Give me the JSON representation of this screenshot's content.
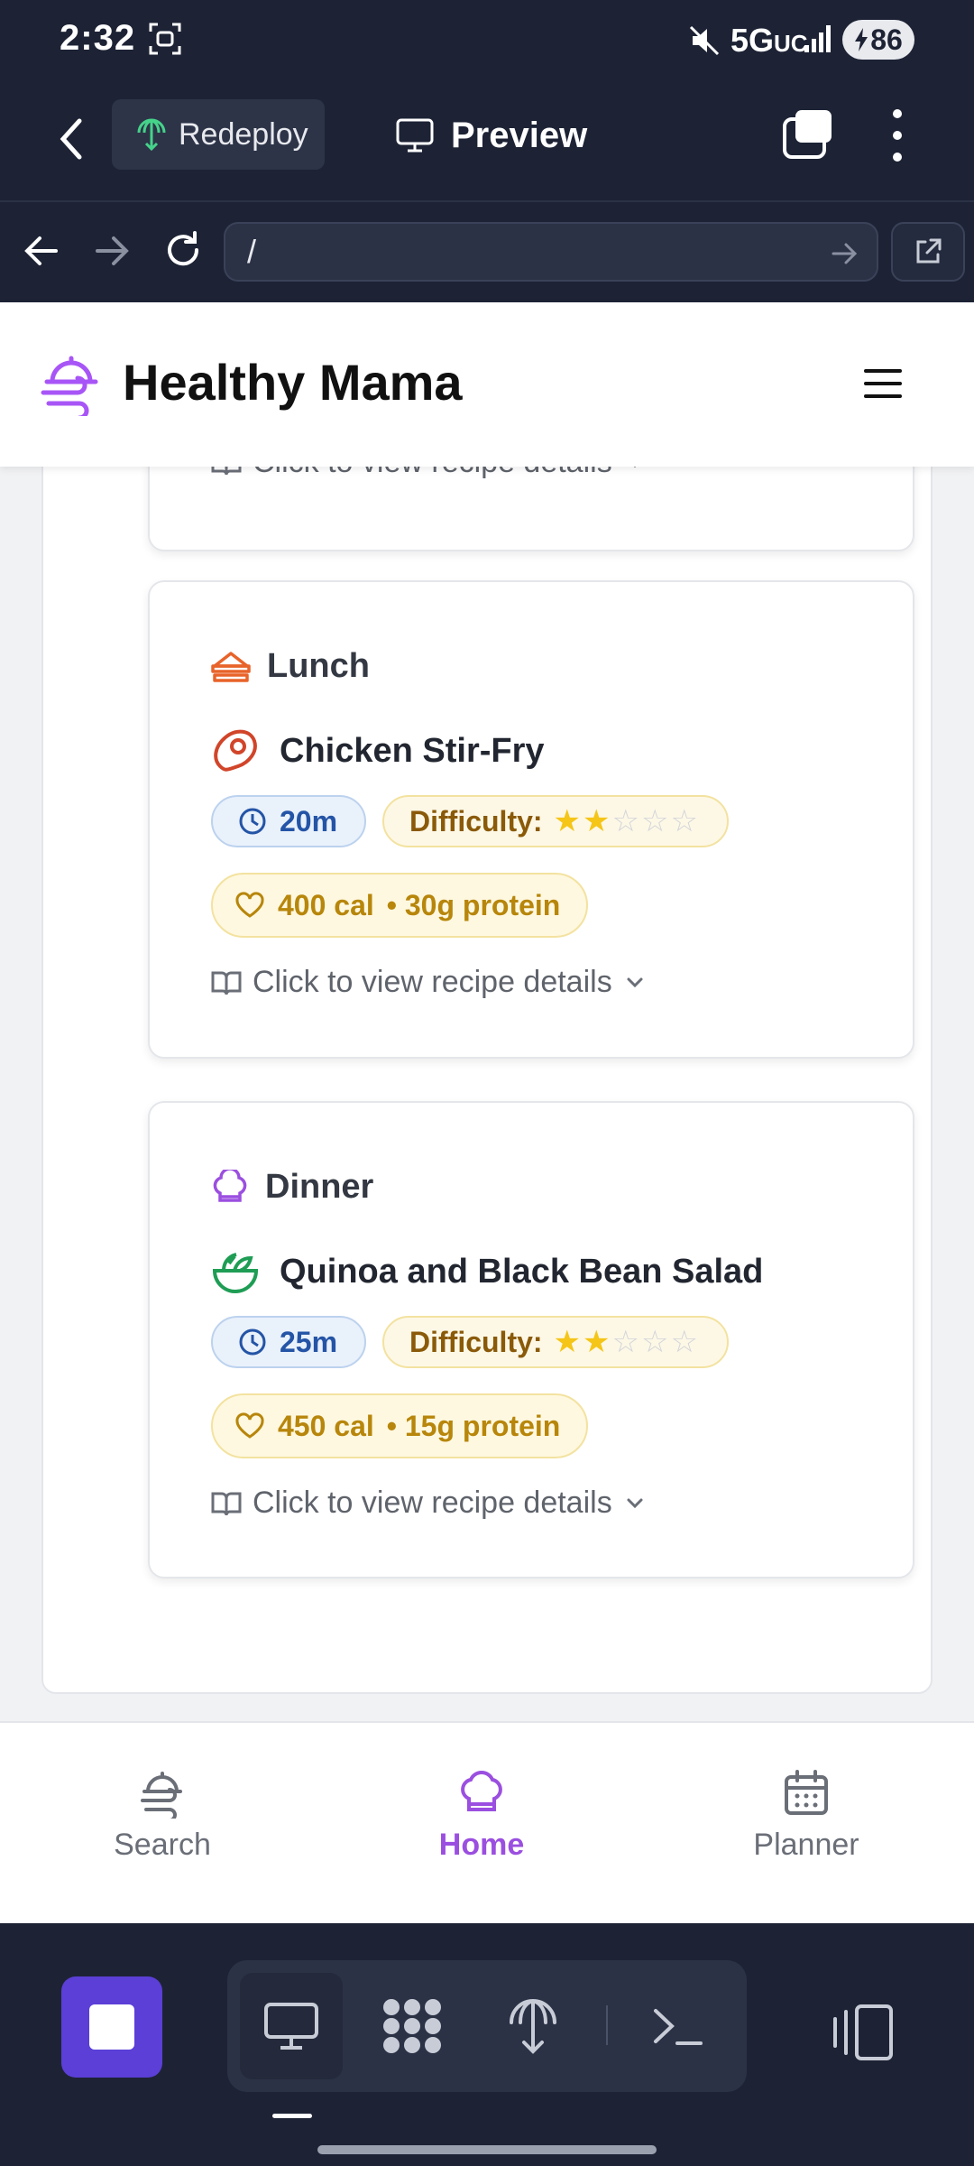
{
  "status_bar": {
    "time": "2:32",
    "network": "5G",
    "network_sub": "UC",
    "battery": "86"
  },
  "app_bar": {
    "redeploy_label": "Redeploy",
    "preview_label": "Preview"
  },
  "url_bar": {
    "url": "/"
  },
  "site": {
    "title": "Healthy Mama"
  },
  "meals": {
    "prev_details": "Click to view recipe details",
    "lunch": {
      "meal": "Lunch",
      "dish": "Chicken Stir-Fry",
      "time": "20m",
      "difficulty_label": "Difficulty:",
      "difficulty": 2,
      "difficulty_max": 5,
      "calories": "400 cal",
      "protein": "• 30g protein",
      "details": "Click to view recipe details"
    },
    "dinner": {
      "meal": "Dinner",
      "dish": "Quinoa and Black Bean Salad",
      "time": "25m",
      "difficulty_label": "Difficulty:",
      "difficulty": 2,
      "difficulty_max": 5,
      "calories": "450 cal",
      "protein": "• 15g protein",
      "details": "Click to view recipe details"
    }
  },
  "bottom_nav": {
    "search": "Search",
    "home": "Home",
    "planner": "Planner",
    "active": "home"
  },
  "colors": {
    "accent": "#9b4fe0",
    "dark_bar": "#1d2335",
    "star": "#f5c518",
    "stop_button": "#5b3fd6"
  },
  "icons": {
    "dock": [
      "monitor-icon",
      "apps-grid-icon",
      "deploy-icon",
      "terminal-icon"
    ],
    "nav": [
      "search-icon",
      "home-chef-hat-icon",
      "calendar-icon"
    ]
  }
}
